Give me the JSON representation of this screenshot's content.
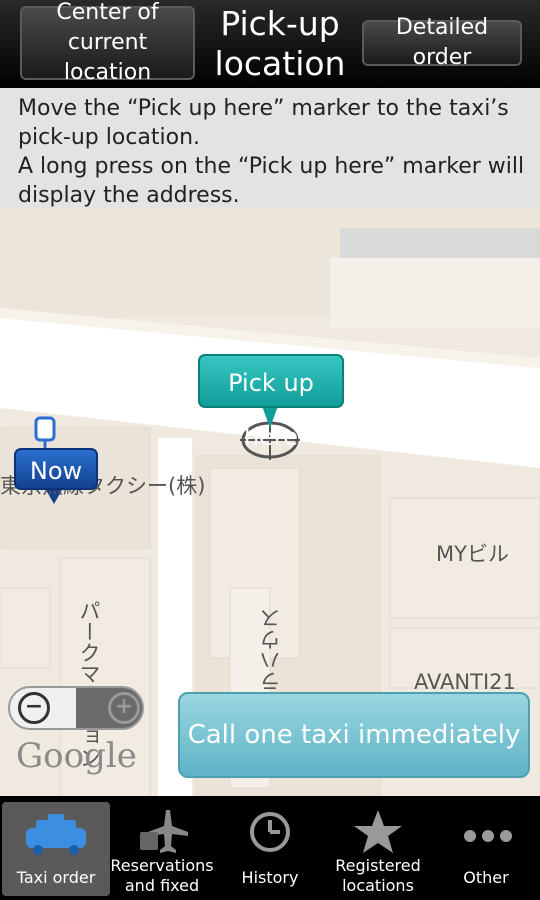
{
  "header": {
    "center_button": "Center of current location",
    "title": "Pick-up location",
    "detailed_button": "Detailed order"
  },
  "instructions": {
    "line1": "Move the “Pick up here” marker to the taxi’s pick-up location.",
    "line2": "A long press on the “Pick up here” marker will display the address."
  },
  "map": {
    "pick_marker": "Pick up here",
    "now_marker": "Now",
    "label_taxi": "東京無線タクシー(株)",
    "label_myb": "MYビル",
    "label_avanti": "AVANTI21",
    "label_mansion": "パークマンション",
    "label_kanji": "サクラハウス",
    "google": "Google",
    "zoom_out": "−",
    "zoom_in": "+"
  },
  "call_button": "Call one taxi immediately",
  "nav": [
    {
      "label": "Taxi order",
      "icon": "taxi-icon",
      "active": true
    },
    {
      "label": "Reservations and fixed",
      "icon": "airplane-icon"
    },
    {
      "label": "History",
      "icon": "clock-icon"
    },
    {
      "label": "Registered locations",
      "icon": "star-icon"
    },
    {
      "label": "Other",
      "icon": "more-dots-icon"
    }
  ]
}
